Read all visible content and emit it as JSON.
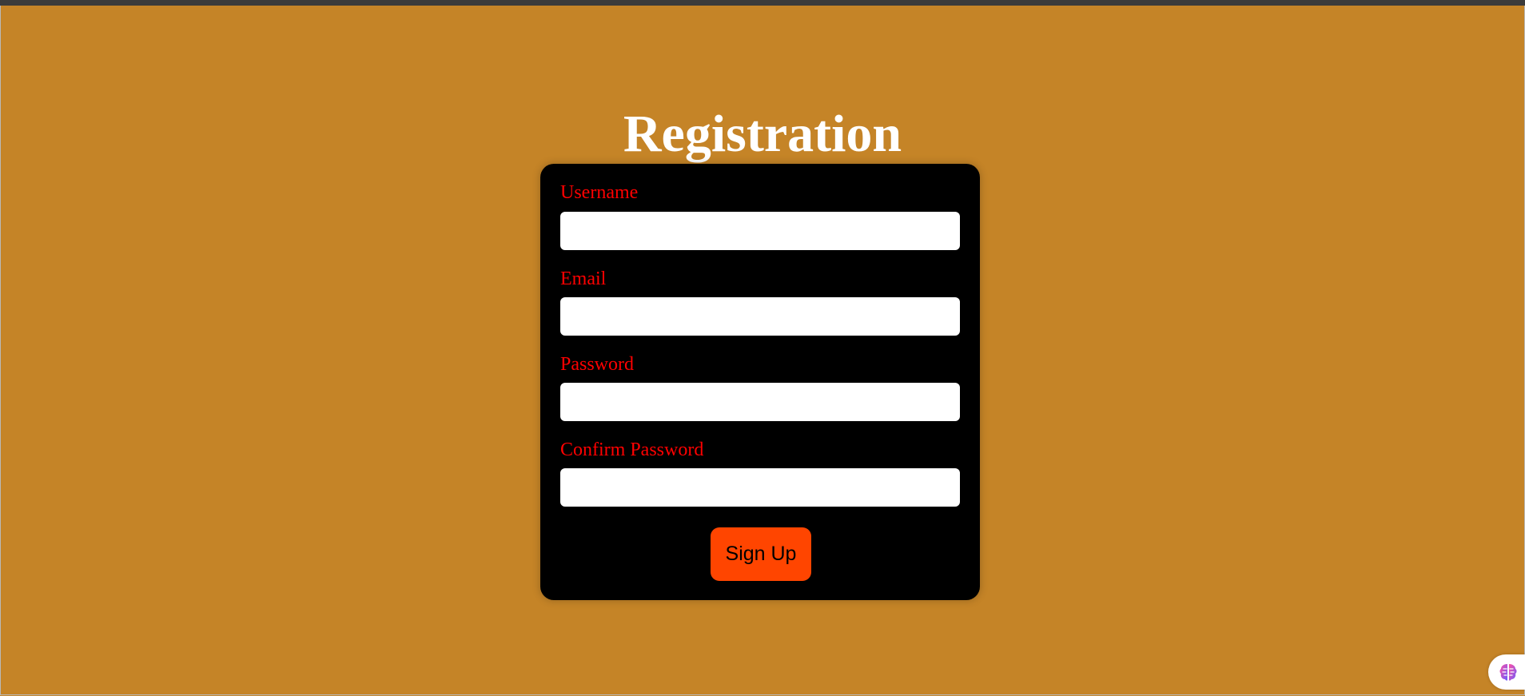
{
  "page": {
    "title": "Registration"
  },
  "form": {
    "fields": [
      {
        "label": "Username",
        "value": "",
        "placeholder": ""
      },
      {
        "label": "Email",
        "value": "",
        "placeholder": ""
      },
      {
        "label": "Password",
        "value": "",
        "placeholder": ""
      },
      {
        "label": "Confirm Password",
        "value": "",
        "placeholder": ""
      }
    ],
    "submit_label": "Sign Up"
  },
  "extension": {
    "icon": "brain-icon"
  },
  "colors": {
    "background": "#c58427",
    "card": "#000000",
    "label": "#ff0000",
    "button": "#ff4500",
    "title": "#ffffff"
  }
}
